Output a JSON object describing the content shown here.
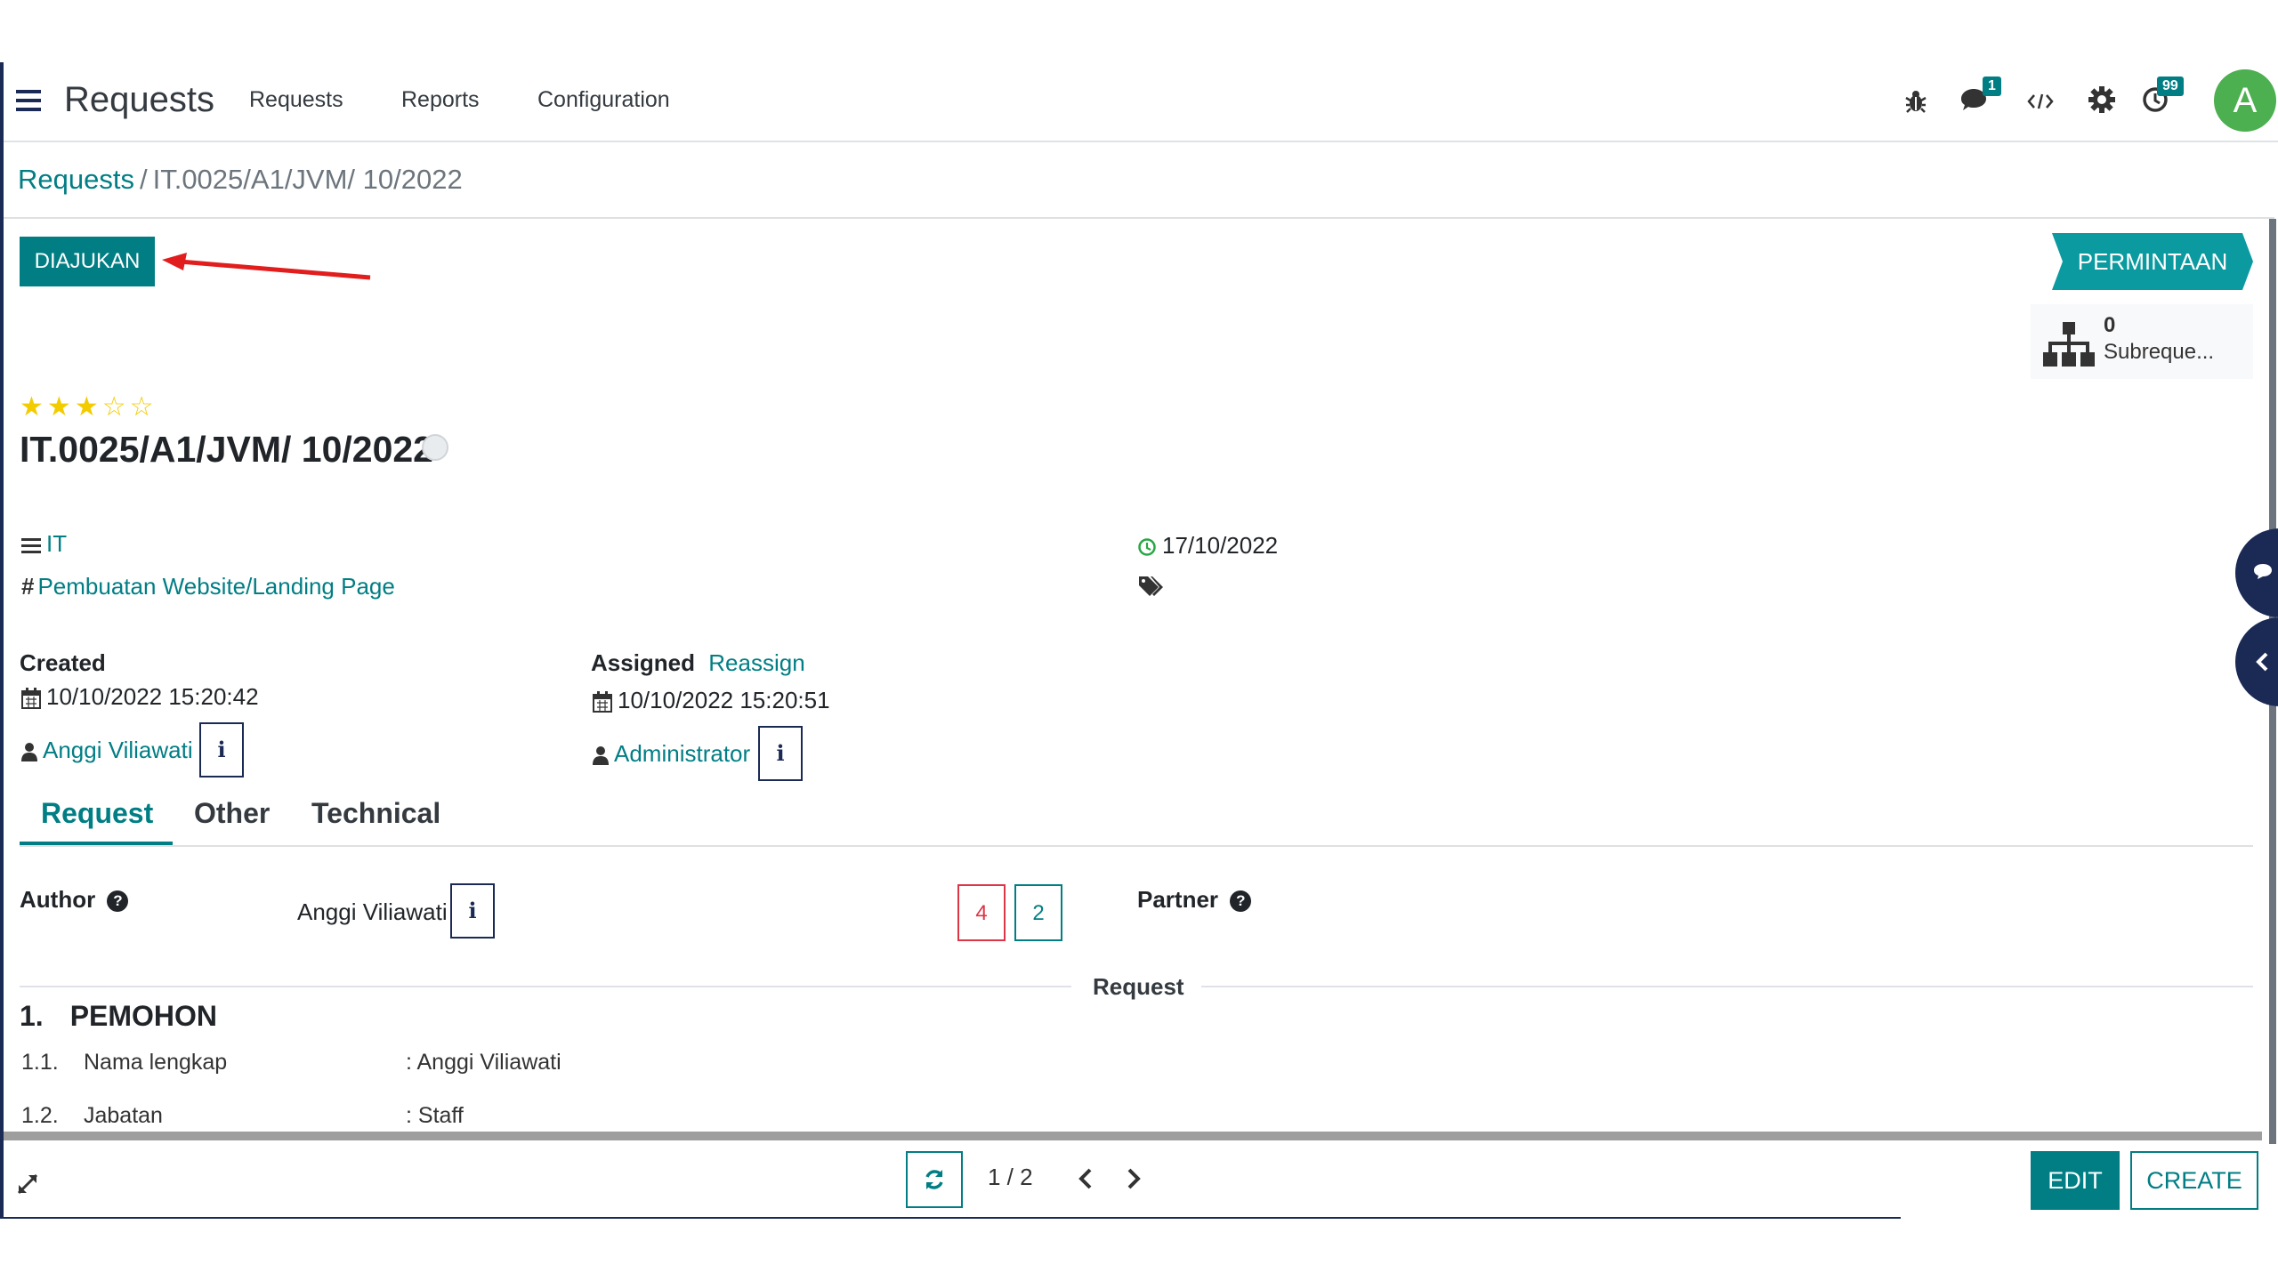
{
  "navbar": {
    "app_title": "Requests",
    "menu": [
      "Requests",
      "Reports",
      "Configuration"
    ],
    "messages_badge": "1",
    "activities_badge": "99",
    "avatar_initial": "A",
    "icons": [
      "bug-icon",
      "chat-icon",
      "code-icon",
      "gear-icon",
      "clock-icon"
    ]
  },
  "breadcrumb": {
    "parent": "Requests",
    "separator": "/",
    "current": "IT.0025/A1/JVM/ 10/2022"
  },
  "status": {
    "state_button": "DIAJUKAN",
    "stage": "PERMINTAAN"
  },
  "smart_button": {
    "count": "0",
    "label": "Subreque..."
  },
  "record": {
    "priority": 3,
    "priority_max": 5,
    "title": "IT.0025/A1/JVM/ 10/2022",
    "category": "IT",
    "type": "Pembuatan Website/Landing Page",
    "deadline": "17/10/2022"
  },
  "created": {
    "label": "Created",
    "date": "10/10/2022 15:20:42",
    "user": "Anggi Viliawati"
  },
  "assigned": {
    "label": "Assigned",
    "action": "Reassign",
    "date": "10/10/2022 15:20:51",
    "user": "Administrator"
  },
  "tabs": [
    "Request",
    "Other",
    "Technical"
  ],
  "author": {
    "label": "Author",
    "help": "?",
    "name": "Anggi Viliawati"
  },
  "counts": [
    "4",
    "2"
  ],
  "partner": {
    "label": "Partner",
    "help": "?"
  },
  "separator_label": "Request",
  "section": {
    "number": "1.",
    "title": "PEMOHON",
    "rows": [
      {
        "num": "1.1.",
        "label": "Nama lengkap",
        "value": ": Anggi Viliawati"
      },
      {
        "num": "1.2.",
        "label": "Jabatan",
        "value": ": Staff"
      }
    ]
  },
  "info_glyph": "i",
  "pager": {
    "text": "1 / 2"
  },
  "actions": {
    "edit": "EDIT",
    "create": "CREATE"
  },
  "colors": {
    "primary": "#017e84",
    "navy": "#1b2a55",
    "star": "#f3cc00",
    "danger": "#dc3545",
    "arrow": "#e11d1d",
    "avatar": "#4caf50"
  }
}
